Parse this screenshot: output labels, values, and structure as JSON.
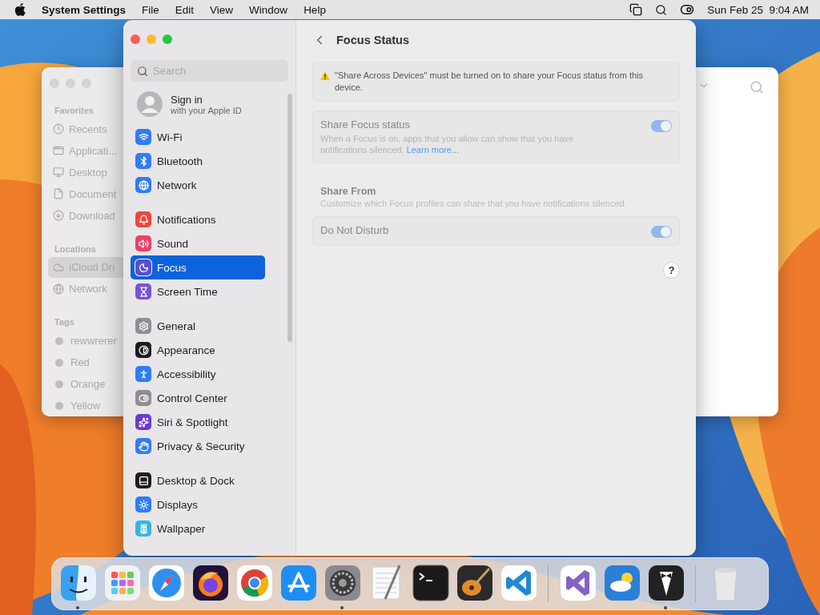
{
  "menu_bar": {
    "app_name": "System Settings",
    "menus": [
      "File",
      "Edit",
      "View",
      "Window",
      "Help"
    ],
    "clock": "Sun Feb 25  9:04 AM"
  },
  "finder_window": {
    "sections": [
      {
        "title": "Favorites",
        "items": [
          {
            "label": "Recents",
            "kind": "clock"
          },
          {
            "label": "Applicati...",
            "kind": "apps"
          },
          {
            "label": "Desktop",
            "kind": "desktop"
          },
          {
            "label": "Document",
            "kind": "file"
          },
          {
            "label": "Download",
            "kind": "download"
          }
        ]
      },
      {
        "title": "Locations",
        "items": [
          {
            "label": "iCloud Dri",
            "kind": "cloud",
            "selected": true
          },
          {
            "label": "Network",
            "kind": "globe",
            "selected": false
          }
        ]
      },
      {
        "title": "Tags",
        "items": [
          {
            "label": "rewwrerer",
            "kind": "dot"
          },
          {
            "label": "Red",
            "kind": "dot"
          },
          {
            "label": "Orange",
            "kind": "dot"
          },
          {
            "label": "Yellow",
            "kind": "dot"
          }
        ]
      }
    ]
  },
  "settings": {
    "search": {
      "placeholder": "Search"
    },
    "account": {
      "title": "Sign in",
      "subtitle": "with your Apple ID"
    },
    "groups": [
      [
        {
          "label": "Wi-Fi",
          "kind": "wifi",
          "color": "#2f7cf6",
          "selected": false
        },
        {
          "label": "Bluetooth",
          "kind": "bluetooth",
          "color": "#2f7cf6",
          "selected": false
        },
        {
          "label": "Network",
          "kind": "globe",
          "color": "#2f7cf6",
          "selected": false
        }
      ],
      [
        {
          "label": "Notifications",
          "kind": "bell",
          "color": "#f0463c",
          "selected": false
        },
        {
          "label": "Sound",
          "kind": "sound",
          "color": "#ee3f63",
          "selected": false
        },
        {
          "label": "Focus",
          "kind": "moon",
          "color": "#5b4ed6",
          "selected": true
        },
        {
          "label": "Screen Time",
          "kind": "hourglass",
          "color": "#7a52d6",
          "selected": false
        }
      ],
      [
        {
          "label": "General",
          "kind": "gear",
          "color": "#8e8e93",
          "selected": false
        },
        {
          "label": "Appearance",
          "kind": "contrast",
          "color": "#1c1c1e",
          "selected": false
        },
        {
          "label": "Accessibility",
          "kind": "person",
          "color": "#2f7cf6",
          "selected": false
        },
        {
          "label": "Control Center",
          "kind": "toggles",
          "color": "#8e8e93",
          "selected": false
        },
        {
          "label": "Siri & Spotlight",
          "kind": "siri",
          "color": "#6c3bd1",
          "selected": false
        },
        {
          "label": "Privacy & Security",
          "kind": "hand",
          "color": "#2f7cf6",
          "selected": false
        }
      ],
      [
        {
          "label": "Desktop & Dock",
          "kind": "dock",
          "color": "#1c1c1e",
          "selected": false
        },
        {
          "label": "Displays",
          "kind": "sun",
          "color": "#2f7cf6",
          "selected": false
        },
        {
          "label": "Wallpaper",
          "kind": "flower",
          "color": "#36b8e0",
          "selected": false
        }
      ]
    ],
    "title": "Focus Status",
    "warning": "\"Share Across Devices\" must be turned on to share your Focus status from this device.",
    "share_status": {
      "title": "Share Focus status",
      "description": "When a Focus is on, apps that you allow can show that you have notifications silenced.",
      "link": "Learn more...",
      "on": true,
      "disabled": true
    },
    "share_from": {
      "title": "Share From",
      "description": "Customize which Focus profiles can share that you have notifications silenced."
    },
    "profiles": [
      {
        "label": "Do Not Disturb",
        "on": true,
        "disabled": true
      }
    ],
    "help": "?"
  },
  "dock": {
    "groups": [
      [
        {
          "kind": "finder",
          "running": true
        },
        {
          "kind": "launchpad",
          "running": false
        },
        {
          "kind": "safari",
          "running": false
        },
        {
          "kind": "firefox",
          "running": false
        },
        {
          "kind": "chrome",
          "running": false
        },
        {
          "kind": "appstore",
          "running": false
        },
        {
          "kind": "settings",
          "running": true
        },
        {
          "kind": "textedit",
          "running": false
        },
        {
          "kind": "terminal",
          "running": false
        },
        {
          "kind": "guitar",
          "running": false
        },
        {
          "kind": "vscode",
          "running": false
        }
      ],
      [
        {
          "kind": "visualstudio",
          "running": false
        },
        {
          "kind": "weather",
          "running": false
        },
        {
          "kind": "tuxedo",
          "running": true
        }
      ],
      [
        {
          "kind": "trash",
          "running": false
        }
      ]
    ]
  }
}
